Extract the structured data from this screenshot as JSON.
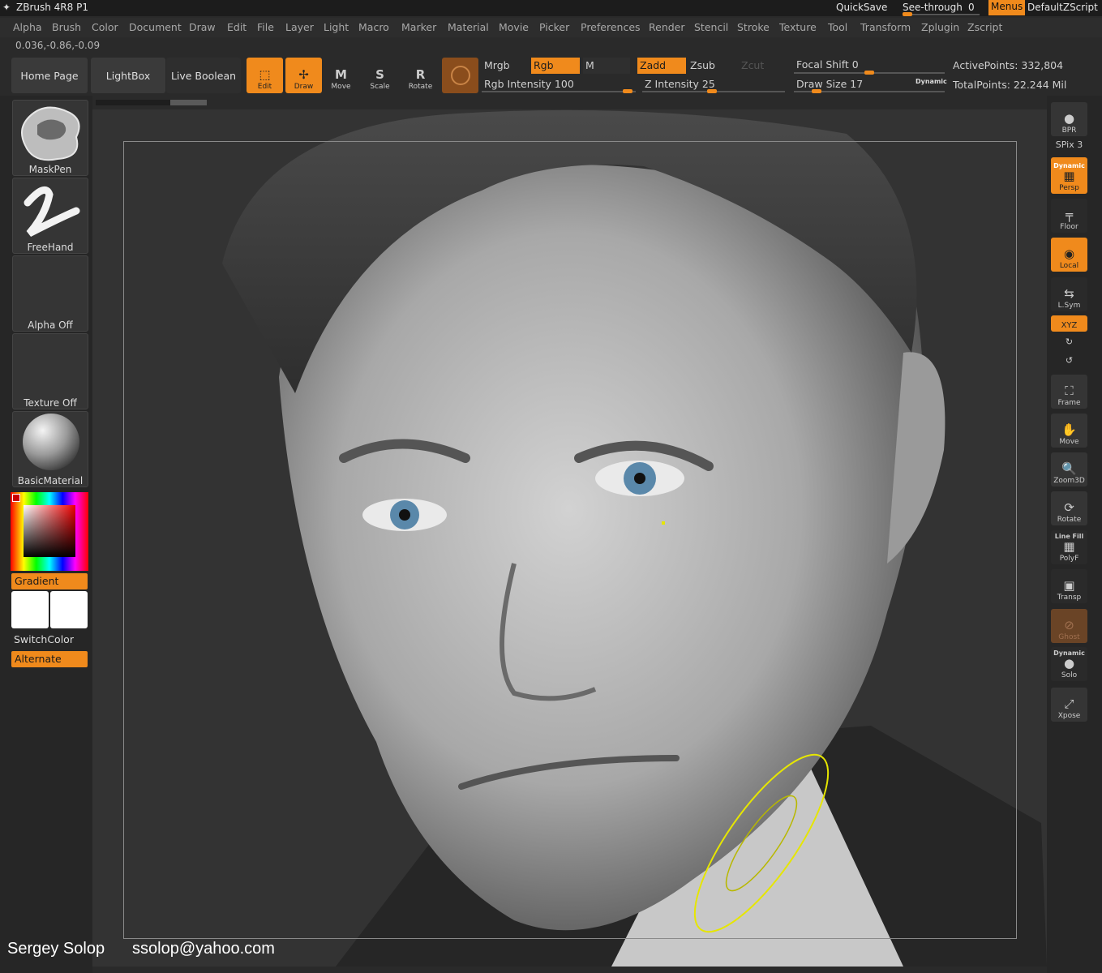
{
  "titlebar": {
    "app_name": "ZBrush 4R8 P1",
    "quicksave": "QuickSave",
    "see_through_label": "See-through",
    "see_through_value": "0",
    "menus": "Menus",
    "script": "DefaultZScript"
  },
  "menubar": [
    "Alpha",
    "Brush",
    "Color",
    "Document",
    "Draw",
    "Edit",
    "File",
    "Layer",
    "Light",
    "Macro",
    "Marker",
    "Material",
    "Movie",
    "Picker",
    "Preferences",
    "Render",
    "Stencil",
    "Stroke",
    "Texture",
    "Tool",
    "Transform",
    "Zplugin",
    "Zscript"
  ],
  "coords": "0.036,-0.86,-0.09",
  "toolbar": {
    "home": "Home Page",
    "lightbox": "LightBox",
    "live_boolean": "Live Boolean",
    "edit": "Edit",
    "draw": "Draw",
    "move": "Move",
    "scale": "Scale",
    "rotate": "Rotate",
    "mrgb": "Mrgb",
    "rgb": "Rgb",
    "m": "M",
    "rgb_intensity": "Rgb Intensity 100",
    "zadd": "Zadd",
    "zsub": "Zsub",
    "zcut": "Zcut",
    "z_intensity": "Z Intensity 25",
    "focal_shift": "Focal Shift 0",
    "draw_size": "Draw Size 17",
    "dynamic": "Dynamic",
    "active_points": "ActivePoints: 332,804",
    "total_points": "TotalPoints: 22.244 Mil"
  },
  "left_shelf": {
    "brush": "MaskPen",
    "stroke": "FreeHand",
    "alpha": "Alpha Off",
    "texture": "Texture Off",
    "material": "BasicMaterial",
    "gradient": "Gradient",
    "switch_color": "SwitchColor",
    "alternate": "Alternate"
  },
  "right_shelf": {
    "bpr": "BPR",
    "spix": "SPix 3",
    "dynamic": "Dynamic",
    "persp": "Persp",
    "floor": "Floor",
    "local": "Local",
    "lsym": "L.Sym",
    "xyz": "XYZ",
    "frame": "Frame",
    "move": "Move",
    "zoom3d": "Zoom3D",
    "rotate": "Rotate",
    "line_fill": "Line Fill",
    "polyf": "PolyF",
    "transp": "Transp",
    "ghost": "Ghost",
    "dynamic2": "Dynamic",
    "solo": "Solo",
    "xpose": "Xpose"
  },
  "credits": {
    "author": "Sergey Solop",
    "email": "ssolop@yahoo.com"
  },
  "colors": {
    "accent": "#f08a1c",
    "panel": "#262626",
    "canvas": "#333333"
  }
}
